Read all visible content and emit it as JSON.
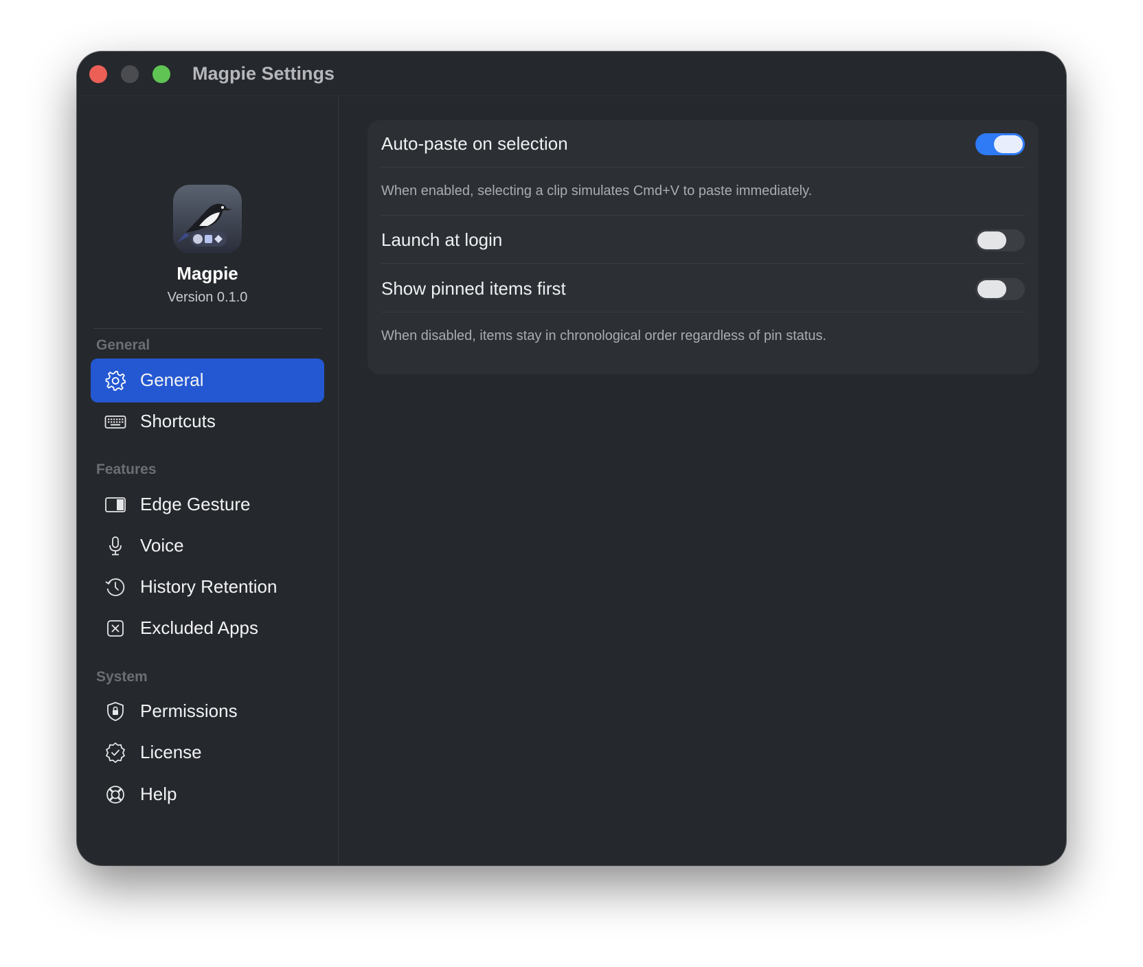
{
  "window": {
    "title": "Magpie Settings"
  },
  "app": {
    "name": "Magpie",
    "version": "Version 0.1.0"
  },
  "sidebar": {
    "sections": [
      {
        "label": "General",
        "items": [
          {
            "label": "General",
            "icon": "gear-icon",
            "active": true
          },
          {
            "label": "Shortcuts",
            "icon": "keyboard-icon"
          }
        ]
      },
      {
        "label": "Features",
        "items": [
          {
            "label": "Edge Gesture",
            "icon": "sidebar-panel-icon"
          },
          {
            "label": "Voice",
            "icon": "microphone-icon"
          },
          {
            "label": "History Retention",
            "icon": "clock-history-icon"
          },
          {
            "label": "Excluded Apps",
            "icon": "x-square-icon"
          }
        ]
      },
      {
        "label": "System",
        "items": [
          {
            "label": "Permissions",
            "icon": "shield-lock-icon"
          },
          {
            "label": "License",
            "icon": "checkmark-seal-icon"
          },
          {
            "label": "Help",
            "icon": "lifebuoy-icon"
          }
        ]
      }
    ]
  },
  "settings": {
    "auto_paste": {
      "label": "Auto-paste on selection",
      "enabled": true,
      "description": "When enabled, selecting a clip simulates Cmd+V to paste immediately."
    },
    "launch_at_login": {
      "label": "Launch at login",
      "enabled": false
    },
    "show_pinned_first": {
      "label": "Show pinned items first",
      "enabled": false,
      "description": "When disabled, items stay in chronological order regardless of pin status."
    }
  },
  "colors": {
    "window_bg": "#25282c",
    "card_bg": "#2c2f33",
    "accent": "#2458d2",
    "toggle_on": "#2f7af5",
    "close": "#ec5f57",
    "minimize_inactive": "#4a4c50",
    "zoom": "#5fc454"
  }
}
